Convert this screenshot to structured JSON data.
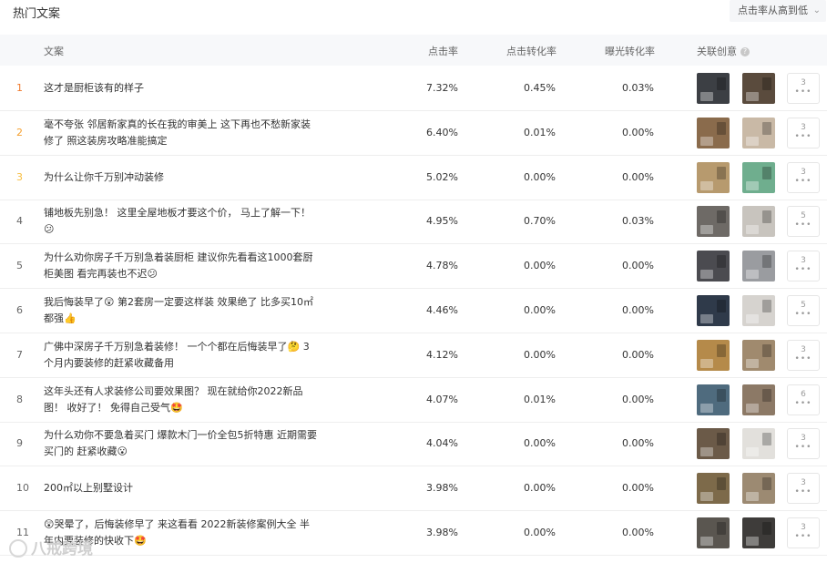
{
  "header": {
    "title": "热门文案",
    "sort_label": "点击率从高到低",
    "help_glyph": "?"
  },
  "columns": {
    "copy": "文案",
    "ctr": "点击率",
    "cvr": "点击转化率",
    "exposure_cvr": "曝光转化率",
    "creatives": "关联创意"
  },
  "rows": [
    {
      "rank": "1",
      "lines": [
        "这才是厨柜该有的样子"
      ],
      "ctr": "7.32%",
      "cvr": "0.45%",
      "ecvr": "0.03%",
      "count": "3",
      "thumbs": [
        "#3c3f44",
        "#5a4b3d"
      ]
    },
    {
      "rank": "2",
      "lines": [
        "毫不夸张 邻居新家真的长在我的审美上 这下再也不愁新家装",
        "修了 照这装房攻略准能搞定"
      ],
      "ctr": "6.40%",
      "cvr": "0.01%",
      "ecvr": "0.00%",
      "count": "3",
      "thumbs": [
        "#8a6b4c",
        "#c9b9a6"
      ]
    },
    {
      "rank": "3",
      "lines": [
        "为什么让你千万别冲动装修"
      ],
      "ctr": "5.02%",
      "cvr": "0.00%",
      "ecvr": "0.00%",
      "count": "3",
      "thumbs": [
        "#b79a6e",
        "#6fae8e"
      ]
    },
    {
      "rank": "4",
      "lines": [
        "铺地板先别急！ 这里全屋地板才要这个价， 马上了解一下！",
        "😕"
      ],
      "ctr": "4.95%",
      "cvr": "0.70%",
      "ecvr": "0.03%",
      "count": "5",
      "thumbs": [
        "#6e6a66",
        "#c8c4be"
      ]
    },
    {
      "rank": "5",
      "lines": [
        "为什么劝你房子千万别急着装厨柜 建议你先看看这1000套厨",
        "柜美图 看完再装也不迟😕"
      ],
      "ctr": "4.78%",
      "cvr": "0.00%",
      "ecvr": "0.00%",
      "count": "3",
      "thumbs": [
        "#4b4b50",
        "#9a9ca0"
      ]
    },
    {
      "rank": "6",
      "lines": [
        "我后悔装早了😲 第2套房一定要这样装 效果绝了 比多买10㎡",
        "都强👍"
      ],
      "ctr": "4.46%",
      "cvr": "0.00%",
      "ecvr": "0.00%",
      "count": "5",
      "thumbs": [
        "#2f3a4a",
        "#d6d3cf"
      ]
    },
    {
      "rank": "7",
      "lines": [
        "广佛中深房子千万别急着装修！ 一个个都在后悔装早了🤔 3",
        "个月内要装修的赶紧收藏备用"
      ],
      "ctr": "4.12%",
      "cvr": "0.00%",
      "ecvr": "0.00%",
      "count": "3",
      "thumbs": [
        "#b58a4a",
        "#a08a6e"
      ]
    },
    {
      "rank": "8",
      "lines": [
        "这年头还有人求装修公司要效果图？ 现在就给你2022新品",
        "图！ 收好了！ 免得自己受气🤩"
      ],
      "ctr": "4.07%",
      "cvr": "0.01%",
      "ecvr": "0.00%",
      "count": "6",
      "thumbs": [
        "#4f6b7e",
        "#8c7966"
      ]
    },
    {
      "rank": "9",
      "lines": [
        "为什么劝你不要急着买门 爆款木门一价全包5折特惠 近期需要",
        "买门的 赶紧收藏😮"
      ],
      "ctr": "4.04%",
      "cvr": "0.00%",
      "ecvr": "0.00%",
      "count": "3",
      "thumbs": [
        "#6b5a48",
        "#e2e0dc"
      ]
    },
    {
      "rank": "10",
      "lines": [
        "200㎡以上别墅设计"
      ],
      "ctr": "3.98%",
      "cvr": "0.00%",
      "ecvr": "0.00%",
      "count": "3",
      "thumbs": [
        "#7d6a4a",
        "#9c8a72"
      ]
    },
    {
      "rank": "11",
      "lines": [
        "😲哭晕了，后悔装修早了 来这看看 2022新装修案例大全 半",
        "年内要装修的快收下🤩"
      ],
      "ctr": "3.98%",
      "cvr": "0.00%",
      "ecvr": "0.00%",
      "count": "3",
      "thumbs": [
        "#5a5650",
        "#3e3c3a"
      ]
    }
  ],
  "watermark": "八戒跨境",
  "icons": {
    "sort_chevron": "chevron-down-icon",
    "help": "question-circle-icon",
    "more": "ellipsis-icon"
  },
  "colors": {
    "rank1": "#f07a2d",
    "rank2": "#f5a030",
    "rank3": "#f7bd3e",
    "header_bg": "#f7f8fa"
  }
}
